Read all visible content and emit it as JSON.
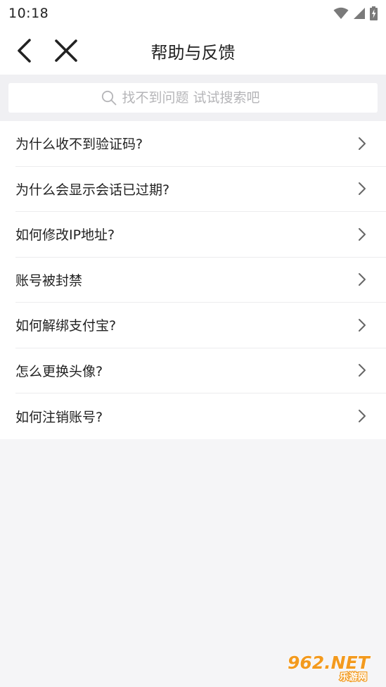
{
  "status_bar": {
    "time": "10:18"
  },
  "header": {
    "title": "帮助与反馈"
  },
  "search": {
    "placeholder": "找不到问题 试试搜索吧"
  },
  "faq": {
    "items": [
      {
        "label": "为什么收不到验证码?"
      },
      {
        "label": "为什么会显示会话已过期?"
      },
      {
        "label": "如何修改IP地址?"
      },
      {
        "label": "账号被封禁"
      },
      {
        "label": "如何解绑支付宝?"
      },
      {
        "label": "怎么更换头像?"
      },
      {
        "label": "如何注销账号?"
      }
    ]
  },
  "watermark": {
    "main": "962.NET",
    "sub": "乐游网"
  },
  "icons": {
    "back": "back-arrow-icon",
    "close": "close-icon",
    "search": "search-icon",
    "chevron": "chevron-right-icon"
  },
  "colors": {
    "text": "#222222",
    "placeholder": "#b5b5b8",
    "page_bg": "#f5f5f7",
    "divider": "#ececee",
    "watermark_orange": "#f39a1e"
  }
}
